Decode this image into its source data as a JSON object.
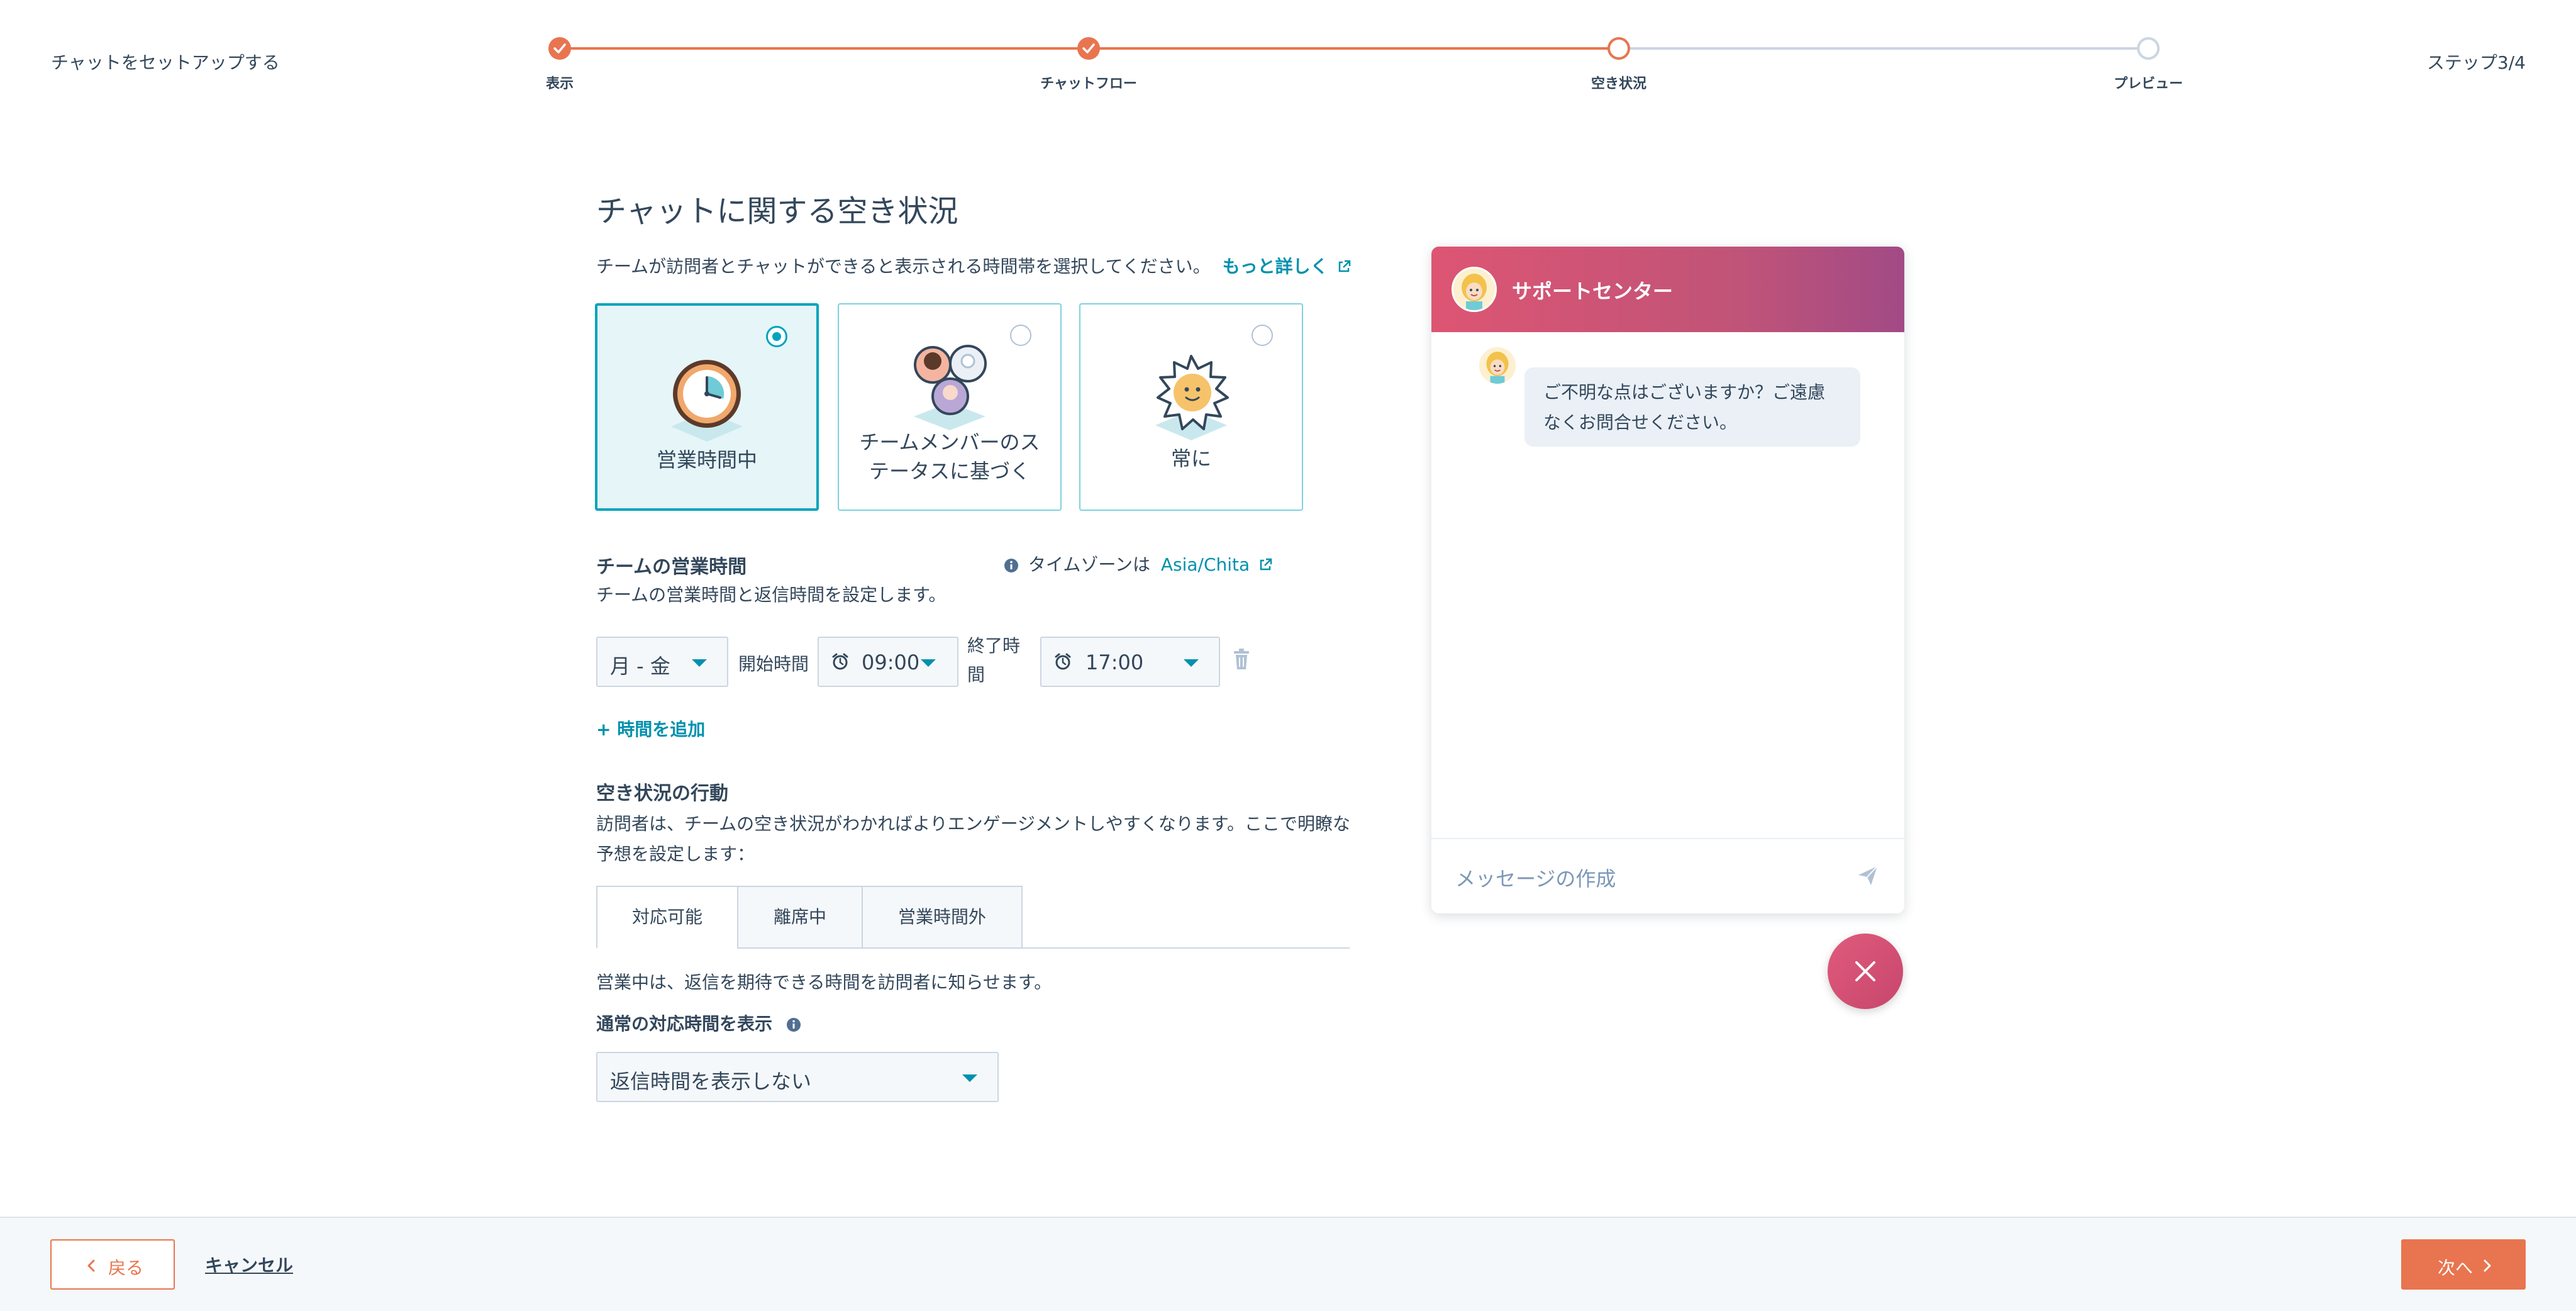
{
  "header": {
    "title": "チャットをセットアップする",
    "step_count": "ステップ3/4",
    "steps": [
      {
        "label": "表示",
        "state": "done"
      },
      {
        "label": "チャットフロー",
        "state": "done"
      },
      {
        "label": "空き状況",
        "state": "current"
      },
      {
        "label": "プレビュー",
        "state": "todo"
      }
    ]
  },
  "main": {
    "title": "チャットに関する空き状況",
    "intro": "チームが訪問者とチャットができると表示される時間帯を選択してください。",
    "learn_more": "もっと詳しく",
    "options": [
      {
        "label": "営業時間中",
        "selected": true
      },
      {
        "label_line1": "チームメンバーのス",
        "label_line2": "テータスに基づく",
        "selected": false
      },
      {
        "label": "常に",
        "selected": false
      }
    ],
    "hours": {
      "title": "チームの営業時間",
      "description": "チームの営業時間と返信時間を設定します。",
      "timezone_prefix": "タイムゾーンは",
      "timezone_value": "Asia/Chita",
      "days_value": "月 - 金",
      "start_label": "開始時間",
      "start_value": "09:00",
      "end_label_line1": "終了時",
      "end_label_line2": "間",
      "end_value": "17:00",
      "add_time": "+ 時間を追加"
    },
    "behavior": {
      "title": "空き状況の行動",
      "description_line1": "訪問者は、チームの空き状況がわかればよりエンゲージメントしやすくなります。ここで明瞭な",
      "description_line2": "予想を設定します：",
      "tabs": [
        "対応可能",
        "離席中",
        "営業時間外"
      ],
      "active_tab": 0,
      "tab_description": "営業中は、返信を期待できる時間を訪問者に知らせます。",
      "reply_label": "通常の対応時間を表示",
      "reply_value": "返信時間を表示しない"
    }
  },
  "chat_preview": {
    "header_title": "サポートセンター",
    "message_line1": "ご不明な点はございますか？ご遠慮",
    "message_line2": "なくお問合せください。",
    "input_placeholder": "メッセージの作成"
  },
  "footer": {
    "back_label": "戻る",
    "cancel_label": "キャンセル",
    "next_label": "次へ"
  },
  "colors": {
    "accent": "#e8754f",
    "teal": "#00a4bd",
    "link": "#0091ae",
    "chat_gradient_start": "#dd5573",
    "chat_gradient_end": "#a24a86",
    "text": "#33475b"
  },
  "icons": [
    "check-icon",
    "clock-icon",
    "team-icon",
    "sun-icon",
    "info-icon",
    "external-link-icon",
    "alarm-clock-icon",
    "trash-icon",
    "send-icon",
    "close-icon",
    "chevron-left-icon",
    "chevron-right-icon"
  ]
}
